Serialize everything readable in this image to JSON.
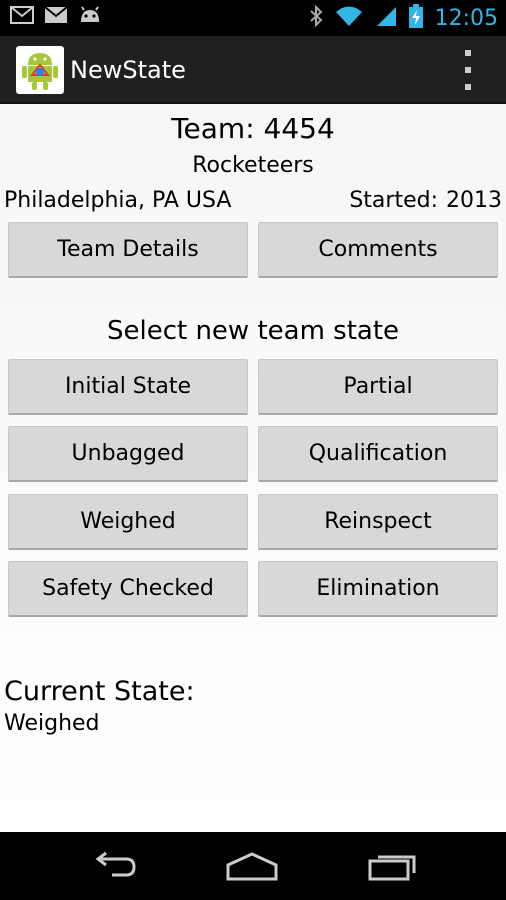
{
  "status_bar": {
    "icons": [
      "gmail-icon",
      "mail-icon",
      "android-debug-icon",
      "bluetooth-icon",
      "wifi-icon",
      "signal-icon",
      "battery-charging-icon"
    ],
    "time": "12:05"
  },
  "action_bar": {
    "app_icon": "android-app-icon",
    "title": "NewState",
    "overflow": "overflow-menu-icon"
  },
  "team": {
    "number_label": "Team: 4454",
    "name": "Rocketeers",
    "location": "Philadelphia, PA USA",
    "started_label": "Started:",
    "started_year": "2013"
  },
  "top_buttons": {
    "details": "Team Details",
    "comments": "Comments"
  },
  "select_label": "Select new team state",
  "state_buttons": [
    "Initial State",
    "Partial",
    "Unbagged",
    "Qualification",
    "Weighed",
    "Reinspect",
    "Safety Checked",
    "Elimination"
  ],
  "current_state": {
    "heading": "Current State:",
    "value": "Weighed"
  },
  "nav_bar": {
    "icons": [
      "back-icon",
      "home-icon",
      "recent-apps-icon"
    ]
  },
  "colors": {
    "clock": "#33b5e5",
    "button_bg": "#d8d8d8",
    "action_bar_bg": "#202020"
  }
}
